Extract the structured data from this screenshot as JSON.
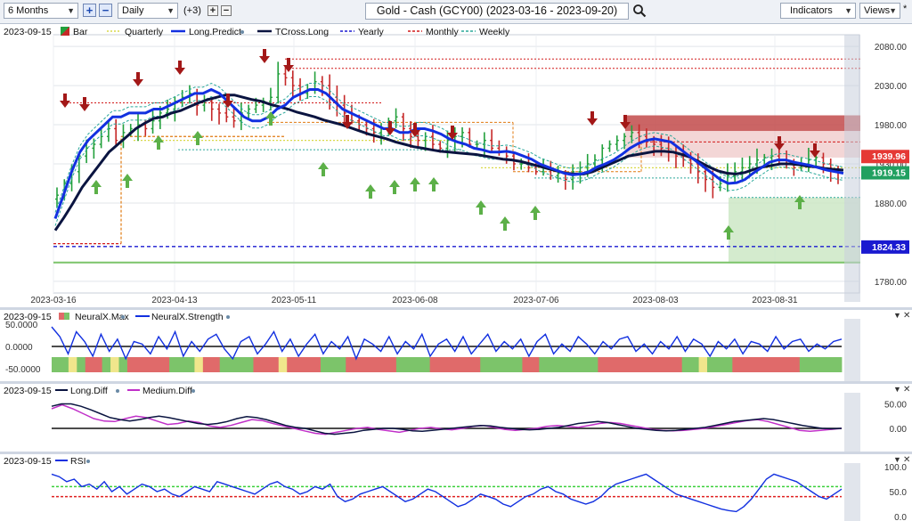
{
  "toolbar": {
    "period": "6 Months",
    "interval": "Daily",
    "overlay_count": "(+3)",
    "symbol_title": "Gold - Cash (GCY00) (2023-03-16 - 2023-09-20)",
    "indicators_label": "Indicators",
    "views_label": "Views",
    "views_marker": "*"
  },
  "colors": {
    "up_bar": "#22a03c",
    "down_bar": "#c62828",
    "long_predict": "#1230e0",
    "tcross_long": "#0a1440",
    "yearly": "#1a1ad0",
    "monthly": "#d21a1a",
    "weekly": "#2aa89a",
    "quarterly": "#d9d94a",
    "neural_green": "#7cc46a",
    "neural_red": "#e06a6a",
    "neural_yellow": "#f0e68c",
    "medium_diff": "#c030c8",
    "rsi_upper": "#3ad03a",
    "rsi_lower": "#e02020"
  },
  "main_panel": {
    "date": "2023-09-15",
    "legend": [
      {
        "label": "Bar",
        "icon": "bar-swatch"
      },
      {
        "label": "Quarterly",
        "icon": "dotted-line-yellow"
      },
      {
        "label": "Long.Predict",
        "icon": "line-blue"
      },
      {
        "label": "TCross.Long",
        "icon": "line-navy"
      },
      {
        "label": "Yearly",
        "icon": "dashed-line-blue"
      },
      {
        "label": "Monthly",
        "icon": "dashed-line-red"
      },
      {
        "label": "Weekly",
        "icon": "dashed-line-teal"
      }
    ],
    "price_labels": [
      {
        "value": "1939.96",
        "color": "#e53935"
      },
      {
        "value": "1919.15",
        "color": "#21a060"
      },
      {
        "value": "1824.33",
        "color": "#1a1ad0"
      }
    ]
  },
  "chart_data": [
    {
      "type": "ohlc-bar",
      "title": "Gold - Cash (GCY00) (2023-03-16 - 2023-09-20)",
      "x_ticks": [
        "2023-03-16",
        "2023-04-13",
        "2023-05-11",
        "2023-06-08",
        "2023-07-06",
        "2023-08-03",
        "2023-08-31"
      ],
      "y_ticks": [
        2080,
        2030,
        1980,
        1930,
        1880,
        1780
      ],
      "ylim": [
        1765,
        2095
      ],
      "closes": [
        1890,
        1905,
        1920,
        1940,
        1950,
        1955,
        1965,
        1975,
        1960,
        1970,
        1975,
        1980,
        1975,
        1985,
        1995,
        2000,
        2010,
        2015,
        2020,
        2005,
        2010,
        2000,
        1995,
        1990,
        1985,
        1995,
        2000,
        2005,
        2010,
        2015,
        2045,
        2040,
        2030,
        2020,
        2025,
        2035,
        2030,
        2015,
        2005,
        1995,
        1985,
        1980,
        1975,
        1970,
        1975,
        1985,
        1990,
        1975,
        1965,
        1960,
        1965,
        1955,
        1950,
        1960,
        1965,
        1970,
        1955,
        1955,
        1960,
        1950,
        1945,
        1940,
        1930,
        1930,
        1925,
        1920,
        1925,
        1915,
        1918,
        1910,
        1920,
        1925,
        1930,
        1935,
        1950,
        1955,
        1960,
        1965,
        1970,
        1965,
        1960,
        1955,
        1950,
        1945,
        1940,
        1935,
        1930,
        1920,
        1910,
        1900,
        1905,
        1915,
        1920,
        1925,
        1930,
        1935,
        1938,
        1940,
        1935,
        1930,
        1925,
        1930,
        1935,
        1938,
        1930,
        1920,
        1919
      ],
      "bar_colors": "alternating per close change",
      "series": [
        {
          "name": "Long.Predict",
          "values": [
            1860,
            1890,
            1920,
            1945,
            1960,
            1970,
            1980,
            1990,
            1990,
            1995,
            1995,
            1995,
            2000,
            2000,
            2005,
            2010,
            2015,
            2020,
            2020,
            2025,
            2020,
            2010,
            2000,
            1990,
            1985,
            1985,
            1990,
            2000,
            2005,
            2015,
            2020,
            2025,
            2025,
            2020,
            2010,
            2000,
            1995,
            1990,
            1985,
            1980,
            1975,
            1975,
            1970,
            1970,
            1975,
            1975,
            1972,
            1968,
            1962,
            1958,
            1955,
            1950,
            1948,
            1945,
            1945,
            1946,
            1944,
            1940,
            1936,
            1930,
            1926,
            1922,
            1918,
            1916,
            1917,
            1920,
            1926,
            1930,
            1935,
            1942,
            1950,
            1956,
            1960,
            1962,
            1960,
            1958,
            1950,
            1942,
            1934,
            1926,
            1918,
            1910,
            1905,
            1906,
            1910,
            1918,
            1925,
            1932,
            1935,
            1935,
            1932,
            1930,
            1928,
            1925,
            1922,
            1920,
            1918
          ]
        },
        {
          "name": "TCross.Long",
          "values": [
            1845,
            1862,
            1880,
            1900,
            1915,
            1930,
            1945,
            1955,
            1965,
            1975,
            1982,
            1988,
            1990,
            1995,
            1998,
            2003,
            2008,
            2012,
            2015,
            2018,
            2018,
            2015,
            2012,
            2010,
            2006,
            2003,
            2000,
            1996,
            1993,
            1990,
            1986,
            1983,
            1980,
            1976,
            1972,
            1968,
            1965,
            1962,
            1958,
            1955,
            1952,
            1950,
            1948,
            1946,
            1945,
            1944,
            1943,
            1942,
            1940,
            1938,
            1936,
            1935,
            1933,
            1930,
            1927,
            1924,
            1921,
            1918,
            1917,
            1917,
            1920,
            1925,
            1930,
            1935,
            1940,
            1942,
            1944,
            1946,
            1946,
            1945,
            1942,
            1938,
            1932,
            1926,
            1921,
            1918,
            1917,
            1919,
            1923,
            1926,
            1928,
            1930,
            1930,
            1929,
            1927,
            1926,
            1924,
            1923,
            1922
          ]
        }
      ],
      "levels": [
        {
          "name": "Yearly",
          "value": 1824.33
        },
        {
          "name": "Monthly",
          "value": 1939.96
        },
        {
          "name": "Weekly",
          "value": 1919.15
        }
      ]
    },
    {
      "type": "line",
      "title": "NeuralX",
      "date": "2023-09-15",
      "series_names": [
        "NeuralX.Max",
        "NeuralX.Strength"
      ],
      "y_ticks": [
        "50.0000",
        "0.0000",
        "-50.0000"
      ],
      "ylim": [
        -60,
        60
      ],
      "strength": [
        40,
        20,
        -15,
        30,
        10,
        -20,
        25,
        -10,
        15,
        -25,
        10,
        5,
        -15,
        20,
        -5,
        30,
        -20,
        10,
        -10,
        15,
        25,
        -5,
        -25,
        10,
        20,
        -15,
        5,
        30,
        -10,
        15,
        -20,
        5,
        25,
        -15,
        10,
        -5,
        20,
        -25,
        15,
        5,
        -10,
        20,
        -15,
        10,
        -5,
        25,
        -20,
        5,
        15,
        -10,
        20,
        -15,
        5,
        25,
        -10,
        10,
        -5,
        15,
        -20,
        10,
        25,
        -15,
        5,
        -10,
        20,
        5,
        -15,
        10,
        -5,
        15,
        20,
        -10,
        5,
        -15,
        10,
        -5,
        20,
        -10,
        15,
        5,
        -20,
        10,
        -5,
        15,
        -15,
        10,
        5,
        -10,
        20,
        -5,
        10,
        15,
        -10,
        5,
        -5,
        10,
        15
      ],
      "state_colors": [
        "g",
        "g",
        "y",
        "g",
        "r",
        "r",
        "g",
        "y",
        "g",
        "r",
        "r",
        "r",
        "r",
        "r",
        "g",
        "g",
        "g",
        "y",
        "r",
        "r",
        "g",
        "g",
        "g",
        "g",
        "r",
        "r",
        "r",
        "y",
        "r",
        "r",
        "r",
        "r",
        "g",
        "g",
        "g",
        "r",
        "r",
        "r",
        "r",
        "r",
        "r",
        "g",
        "g",
        "g",
        "g",
        "r",
        "r",
        "r",
        "r",
        "r",
        "r",
        "g",
        "g",
        "g",
        "g",
        "g",
        "r",
        "r",
        "g",
        "g",
        "g",
        "g",
        "g",
        "g",
        "g",
        "r",
        "r",
        "r",
        "r",
        "r",
        "r",
        "r",
        "r",
        "r",
        "r",
        "g",
        "g",
        "y",
        "g",
        "g",
        "g",
        "r",
        "r",
        "r",
        "r",
        "r",
        "r",
        "r",
        "r",
        "g",
        "g",
        "g",
        "g",
        "g"
      ]
    },
    {
      "type": "line",
      "title": "Diff",
      "date": "2023-09-15",
      "series_names": [
        "Long.Diff",
        "Medium.Diff"
      ],
      "y_ticks": [
        "50.00",
        "0.00"
      ],
      "ylim": [
        -25,
        60
      ],
      "long_diff": [
        45,
        50,
        50,
        45,
        38,
        30,
        22,
        18,
        15,
        18,
        22,
        25,
        22,
        18,
        14,
        10,
        8,
        10,
        14,
        20,
        24,
        22,
        18,
        12,
        6,
        2,
        0,
        -5,
        -10,
        -12,
        -10,
        -8,
        -4,
        -2,
        0,
        0,
        -2,
        -5,
        -6,
        -4,
        -2,
        0,
        2,
        4,
        6,
        5,
        2,
        0,
        -2,
        -3,
        -2,
        0,
        2,
        6,
        10,
        12,
        14,
        12,
        8,
        4,
        0,
        -2,
        -4,
        -5,
        -4,
        -2,
        0,
        2,
        6,
        10,
        14,
        16,
        18,
        20,
        18,
        14,
        10,
        6,
        3,
        0,
        -1,
        0
      ],
      "medium_diff": [
        40,
        48,
        40,
        30,
        20,
        15,
        14,
        20,
        25,
        22,
        15,
        8,
        10,
        15,
        12,
        5,
        2,
        6,
        12,
        18,
        16,
        10,
        5,
        0,
        -5,
        -10,
        -12,
        -8,
        -4,
        0,
        2,
        -2,
        -5,
        -8,
        -4,
        0,
        2,
        -1,
        -3,
        0,
        4,
        6,
        2,
        -2,
        -4,
        -2,
        0,
        4,
        6,
        4,
        2,
        6,
        10,
        12,
        10,
        6,
        2,
        -2,
        -4,
        -5,
        -4,
        -2,
        0,
        4,
        8,
        12,
        16,
        18,
        14,
        8,
        2,
        -4,
        -6,
        -4,
        -2,
        0
      ]
    },
    {
      "type": "line",
      "title": "RSI",
      "date": "2023-09-15",
      "series_names": [
        "RSI"
      ],
      "y_ticks": [
        "100.0",
        "50.0",
        "0.0"
      ],
      "ylim": [
        0,
        100
      ],
      "upper_level": 60,
      "lower_level": 40,
      "rsi": [
        85,
        80,
        70,
        75,
        60,
        65,
        55,
        70,
        50,
        60,
        45,
        55,
        65,
        60,
        50,
        55,
        45,
        40,
        50,
        60,
        55,
        50,
        70,
        65,
        60,
        55,
        50,
        45,
        55,
        65,
        70,
        60,
        55,
        45,
        50,
        60,
        55,
        65,
        40,
        30,
        35,
        45,
        50,
        55,
        60,
        50,
        40,
        30,
        35,
        45,
        55,
        50,
        40,
        30,
        20,
        25,
        35,
        45,
        40,
        35,
        25,
        20,
        30,
        40,
        45,
        55,
        60,
        50,
        45,
        35,
        30,
        25,
        30,
        40,
        55,
        65,
        70,
        75,
        80,
        85,
        75,
        65,
        55,
        45,
        40,
        35,
        30,
        25,
        20,
        15,
        12,
        10,
        20,
        35,
        55,
        75,
        85,
        80,
        75,
        70,
        60,
        50,
        40,
        35,
        45,
        55
      ]
    }
  ],
  "neural_panel": {
    "date": "2023-09-15",
    "legend": [
      {
        "label": "NeuralX.Max"
      },
      {
        "label": "NeuralX.Strength"
      }
    ],
    "ticks": [
      "50.0000",
      "0.0000",
      "-50.0000"
    ]
  },
  "diff_panel": {
    "date": "2023-09-15",
    "legend": [
      {
        "label": "Long.Diff"
      },
      {
        "label": "Medium.Diff"
      }
    ],
    "ticks": [
      "50.00",
      "0.00"
    ]
  },
  "rsi_panel": {
    "date": "2023-09-15",
    "legend": [
      {
        "label": "RSI"
      }
    ],
    "ticks": [
      "100.0",
      "50.0",
      "0.0"
    ]
  }
}
